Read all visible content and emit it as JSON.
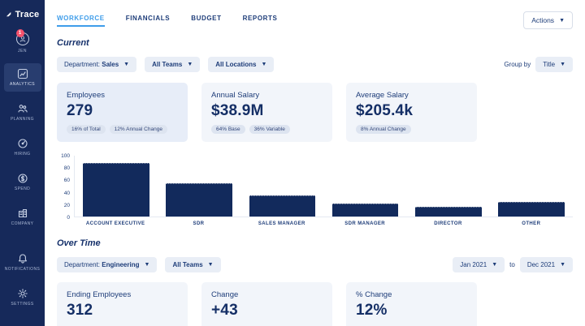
{
  "brand": {
    "name": "Trace"
  },
  "sidebar": {
    "user": {
      "name": "JEN",
      "badge": "1"
    },
    "items": [
      {
        "label": "ANALYTICS"
      },
      {
        "label": "PLANNING"
      },
      {
        "label": "HIRING"
      },
      {
        "label": "SPEND"
      },
      {
        "label": "COMPANY"
      }
    ],
    "footer_items": [
      {
        "label": "NOTIFICATIONS"
      },
      {
        "label": "SETTINGS"
      }
    ]
  },
  "topnav": {
    "tabs": [
      {
        "label": "WORKFORCE"
      },
      {
        "label": "FINANCIALS"
      },
      {
        "label": "BUDGET"
      },
      {
        "label": "REPORTS"
      }
    ],
    "actions_label": "Actions"
  },
  "current_section": {
    "title": "Current",
    "filters": [
      {
        "label": "Department:",
        "value": "Sales"
      },
      {
        "value": "All Teams"
      },
      {
        "value": "All Locations"
      }
    ],
    "group_by_label": "Group by",
    "group_by_value": "Title",
    "cards": [
      {
        "title": "Employees",
        "value": "279",
        "badge1": "16% of Total",
        "badge2": "12% Annual Change"
      },
      {
        "title": "Annual Salary",
        "value": "$38.9M",
        "badge1": "64% Base",
        "badge2": "36% Variable"
      },
      {
        "title": "Average Salary",
        "value": "$205.4k",
        "badge1": "8% Annual Change"
      }
    ]
  },
  "chart_data": {
    "type": "bar",
    "categories": [
      "ACCOUNT EXECUTIVE",
      "SDR",
      "SALES MANAGER",
      "SDR MANAGER",
      "DIRECTOR",
      "OTHER"
    ],
    "values": [
      88,
      55,
      35,
      21,
      16,
      24
    ],
    "title": "",
    "xlabel": "",
    "ylabel": "",
    "ylim": [
      0,
      100
    ],
    "yticks": [
      0,
      20,
      40,
      60,
      80,
      100
    ],
    "grid": false,
    "bar_color": "#122A5C"
  },
  "overtime_section": {
    "title": "Over Time",
    "filters": [
      {
        "label": "Department:",
        "value": "Engineering"
      },
      {
        "value": "All Teams"
      }
    ],
    "date_range": {
      "start": "Jan 2021",
      "separator": "to",
      "end": "Dec 2021"
    },
    "cards": [
      {
        "title": "Ending Employees",
        "value": "312"
      },
      {
        "title": "Change",
        "value": "+43"
      },
      {
        "title": "% Change",
        "value": "12%"
      }
    ]
  },
  "colors": {
    "sidebar_bg": "#16295A",
    "accent_blue": "#3E9DEA",
    "navy_text": "#1E3D79",
    "bar": "#122A5C",
    "badge_red": "#F4516C",
    "card_selected_bg": "#E7EDF8",
    "card_bg": "#F2F5FA"
  }
}
